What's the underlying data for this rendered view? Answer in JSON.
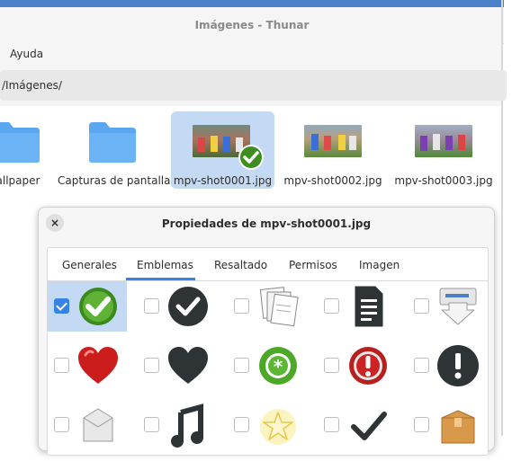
{
  "window": {
    "title": "Imágenes - Thunar"
  },
  "menubar": {
    "items": [
      "Ayuda"
    ]
  },
  "location": {
    "path": "/Imágenes/"
  },
  "files": [
    {
      "name": "allpaper",
      "icon": "folder-icon"
    },
    {
      "name": "Capturas de pantalla",
      "icon": "folder-icon"
    },
    {
      "name": "mpv-shot0001.jpg",
      "icon": "image-thumbnail",
      "selected": true
    },
    {
      "name": "mpv-shot0002.jpg",
      "icon": "image-thumbnail"
    },
    {
      "name": "mpv-shot0003.jpg",
      "icon": "image-thumbnail"
    }
  ],
  "dialog": {
    "title": "Propiedades de mpv-shot0001.jpg",
    "close_label": "×",
    "tabs": [
      "Generales",
      "Emblemas",
      "Resaltado",
      "Permisos",
      "Imagen"
    ],
    "active_tab": "Emblemas",
    "emblems": [
      {
        "icon": "emblem-default-icon",
        "checked": true
      },
      {
        "icon": "emblem-ok-dark-icon",
        "checked": false
      },
      {
        "icon": "emblem-documents-icon",
        "checked": false
      },
      {
        "icon": "emblem-document-icon",
        "checked": false
      },
      {
        "icon": "emblem-downloads-icon",
        "checked": false
      },
      {
        "icon": "emblem-favorite-icon",
        "checked": false
      },
      {
        "icon": "emblem-heart-dark-icon",
        "checked": false
      },
      {
        "icon": "emblem-new-icon",
        "checked": false
      },
      {
        "icon": "emblem-important-icon",
        "checked": false
      },
      {
        "icon": "emblem-important-dark-icon",
        "checked": false
      },
      {
        "icon": "emblem-package-icon",
        "checked": false
      },
      {
        "icon": "emblem-music-icon",
        "checked": false
      },
      {
        "icon": "emblem-star-icon",
        "checked": false
      },
      {
        "icon": "emblem-check-icon",
        "checked": false
      },
      {
        "icon": "emblem-box-icon",
        "checked": false
      }
    ]
  },
  "colors": {
    "accent": "#3584e4",
    "selection": "#c4d9f3",
    "folder": "#5aa6f0"
  }
}
